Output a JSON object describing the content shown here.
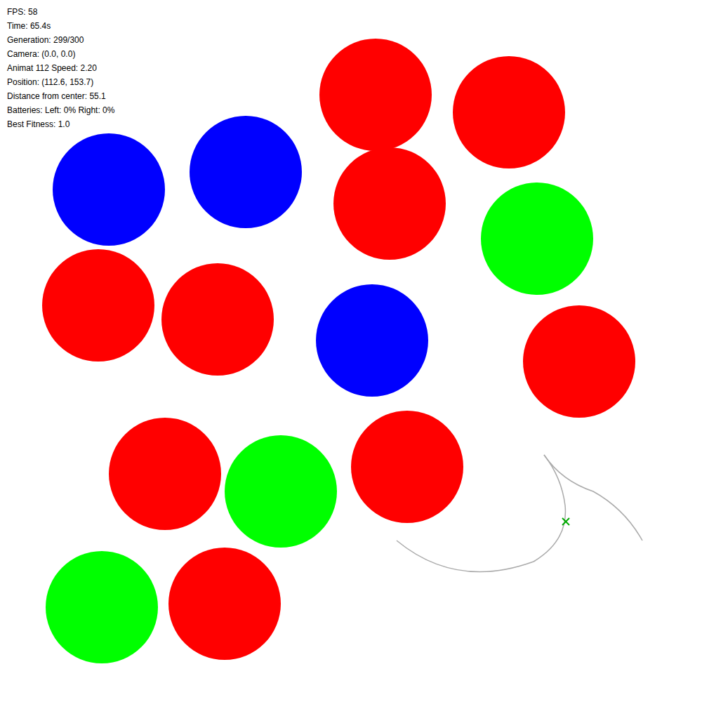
{
  "hud": [
    "FPS: 58",
    "Time: 65.4s",
    "Generation: 299/300",
    "Camera: (0.0, 0.0)",
    "Animat 112 Speed: 2.20",
    "Position: (112.6, 153.7)",
    "Distance from center: 55.1",
    "Batteries: Left: 0% Right: 0%",
    "Best Fitness: 1.0"
  ],
  "objects": [
    {
      "color": "#ff0000"
    },
    {
      "color": "#ff0000"
    },
    {
      "color": "#0000ff"
    },
    {
      "color": "#0000ff"
    },
    {
      "color": "#ff0000"
    },
    {
      "color": "#00ff00"
    },
    {
      "color": "#ff0000"
    },
    {
      "color": "#ff0000"
    },
    {
      "color": "#0000ff"
    },
    {
      "color": "#ff0000"
    },
    {
      "color": "#ff0000"
    },
    {
      "color": "#00ff00"
    },
    {
      "color": "#ff0000"
    },
    {
      "color": "#00ff00"
    },
    {
      "color": "#ff0000"
    }
  ]
}
